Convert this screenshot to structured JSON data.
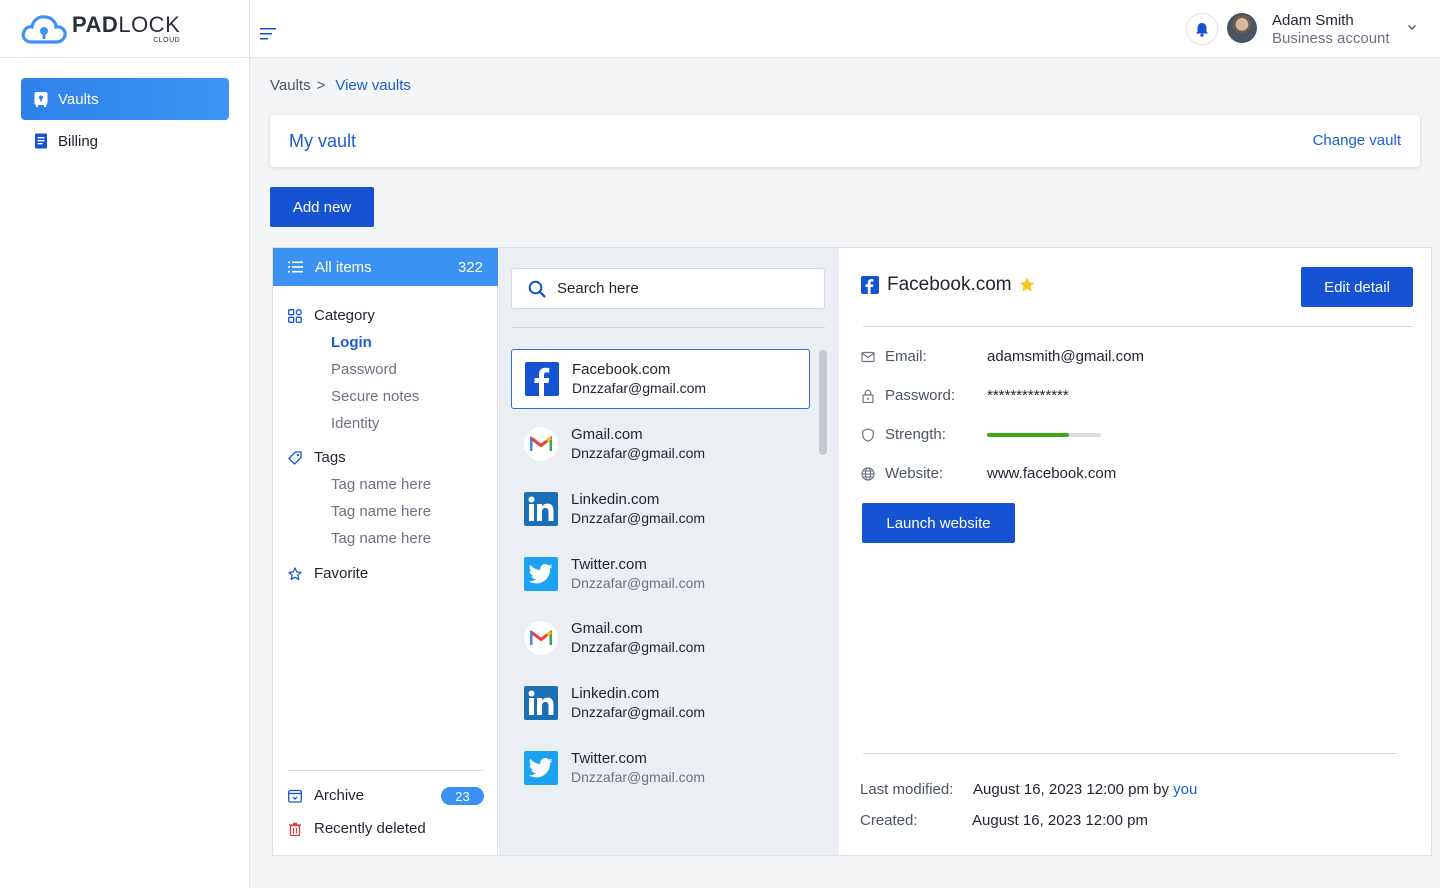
{
  "brand": {
    "name_bold": "PAD",
    "name_light": "LOCK",
    "sub": "CLOUD"
  },
  "sidebar": {
    "items": [
      {
        "label": "Vaults",
        "active": true
      },
      {
        "label": "Billing",
        "active": false
      }
    ]
  },
  "user": {
    "name": "Adam Smith",
    "role": "Business account"
  },
  "breadcrumb": {
    "parent": "Vaults",
    "separator": ">",
    "current": "View vaults"
  },
  "vault": {
    "title": "My vault",
    "change_label": "Change vault"
  },
  "actions": {
    "add_new": "Add new"
  },
  "categories": {
    "all_items_label": "All items",
    "all_items_count": "322",
    "category_label": "Category",
    "category_items": [
      "Login",
      "Password",
      "Secure notes",
      "Identity"
    ],
    "tags_label": "Tags",
    "tag_items": [
      "Tag name here",
      "Tag name here",
      "Tag name here"
    ],
    "favorite_label": "Favorite",
    "archive_label": "Archive",
    "archive_count": "23",
    "deleted_label": "Recently deleted"
  },
  "search": {
    "placeholder": "Search here"
  },
  "list": [
    {
      "site": "Facebook.com",
      "email": "Dnzzafar@gmail.com",
      "icon": "facebook-icon",
      "selected": true
    },
    {
      "site": "Gmail.com",
      "email": "Dnzzafar@gmail.com",
      "icon": "gmail-icon"
    },
    {
      "site": "Linkedin.com",
      "email": "Dnzzafar@gmail.com",
      "icon": "linkedin-icon"
    },
    {
      "site": "Twitter.com",
      "email": "Dnzzafar@gmail.com",
      "icon": "twitter-icon"
    },
    {
      "site": "Gmail.com",
      "email": "Dnzzafar@gmail.com",
      "icon": "gmail-icon"
    },
    {
      "site": "Linkedin.com",
      "email": "Dnzzafar@gmail.com",
      "icon": "linkedin-icon"
    },
    {
      "site": "Twitter.com",
      "email": "Dnzzafar@gmail.com",
      "icon": "twitter-icon"
    }
  ],
  "detail": {
    "title": "Facebook.com",
    "favorite": true,
    "edit_label": "Edit detail",
    "email_label": "Email:",
    "email_value": "adamsmith@gmail.com",
    "password_label": "Password:",
    "password_value": "**************",
    "strength_label": "Strength:",
    "strength_value": 0.72,
    "website_label": "Website:",
    "website_value": "www.facebook.com",
    "launch_label": "Launch website",
    "modified_label": "Last modified:",
    "modified_value": "August 16, 2023 12:00 pm by",
    "modified_by": "you",
    "created_label": "Created:",
    "created_value": "August 16, 2023 12:00 pm"
  },
  "colors": {
    "primary": "#1553d2",
    "accent": "#3b92f2",
    "strength": "#3ea915",
    "star": "#f5c518",
    "facebook": "#1553d2",
    "twitter": "#1da1f2",
    "linkedin": "#1a6fb5"
  }
}
